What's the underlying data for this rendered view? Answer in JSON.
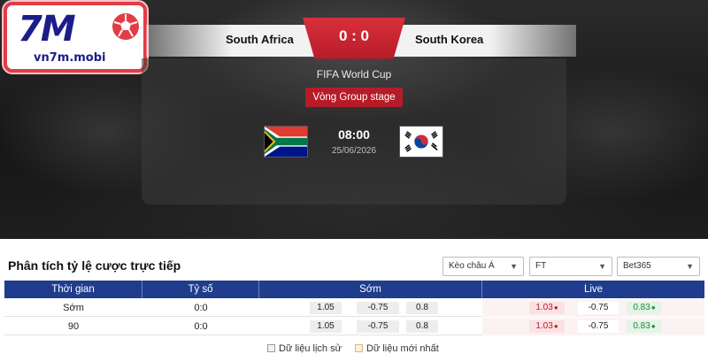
{
  "logo": {
    "mark": "7M",
    "domain": "vn7m.mobi"
  },
  "match": {
    "home_team": "South Africa",
    "away_team": "South Korea",
    "score": "0 : 0",
    "competition": "FIFA World Cup",
    "stage": "Vòng Group stage",
    "time": "08:00",
    "date": "25/06/2026",
    "home_flag": "south-africa-flag",
    "away_flag": "south-korea-flag"
  },
  "odds": {
    "title": "Phân tích tỷ lệ cược trực tiếp",
    "filters": [
      {
        "value": "Kèo châu Á"
      },
      {
        "value": "FT"
      },
      {
        "value": "Bet365"
      }
    ],
    "headers": [
      "Thời gian",
      "Tỷ số",
      "Sớm",
      "Live"
    ],
    "rows": [
      {
        "time": "Sớm",
        "score": "0:0",
        "early": [
          "1.05",
          "-0.75",
          "0.8"
        ],
        "live": [
          "1.03",
          "-0.75",
          "0.83"
        ]
      },
      {
        "time": "90",
        "score": "0:0",
        "early": [
          "1.05",
          "-0.75",
          "0.8"
        ],
        "live": [
          "1.03",
          "-0.75",
          "0.83"
        ]
      }
    ],
    "legend": [
      "Dữ liệu lịch sử",
      "Dữ liệu mới nhất"
    ]
  },
  "colors": {
    "accent_red": "#b61c28",
    "header_blue": "#1f3d8c",
    "logo_blue": "#1c1c8a"
  }
}
